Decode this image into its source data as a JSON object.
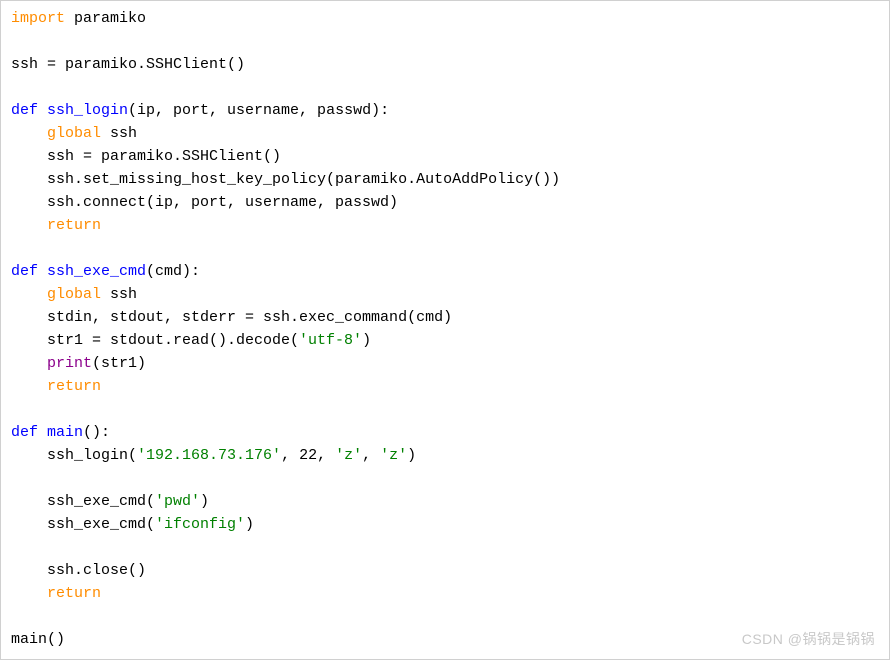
{
  "code": {
    "l1_import": "import",
    "l1_module": " paramiko",
    "l3": "ssh = paramiko.SSHClient()",
    "l5_def": "def",
    "l5_name": " ssh_login",
    "l5_params": "(ip, port, username, passwd):",
    "l6_global": "    global",
    "l6_rest": " ssh",
    "l7": "    ssh = paramiko.SSHClient()",
    "l8": "    ssh.set_missing_host_key_policy(paramiko.AutoAddPolicy())",
    "l9": "    ssh.connect(ip, port, username, passwd)",
    "l10_return": "    return",
    "l12_def": "def",
    "l12_name": " ssh_exe_cmd",
    "l12_params": "(cmd):",
    "l13_global": "    global",
    "l13_rest": " ssh",
    "l14": "    stdin, stdout, stderr = ssh.exec_command(cmd)",
    "l15_a": "    str1 = stdout.read().decode(",
    "l15_str": "'utf-8'",
    "l15_b": ")",
    "l16_print": "    print",
    "l16_rest": "(str1)",
    "l17_return": "    return",
    "l19_def": "def",
    "l19_name": " main",
    "l19_params": "():",
    "l20_a": "    ssh_login(",
    "l20_s1": "'192.168.73.176'",
    "l20_b": ", 22, ",
    "l20_s2": "'z'",
    "l20_c": ", ",
    "l20_s3": "'z'",
    "l20_d": ")",
    "l22_a": "    ssh_exe_cmd(",
    "l22_s": "'pwd'",
    "l22_b": ")",
    "l23_a": "    ssh_exe_cmd(",
    "l23_s": "'ifconfig'",
    "l23_b": ")",
    "l25": "    ssh.close()",
    "l26_return": "    return",
    "l28": "main()"
  },
  "watermark": "CSDN @锅锅是锅锅"
}
